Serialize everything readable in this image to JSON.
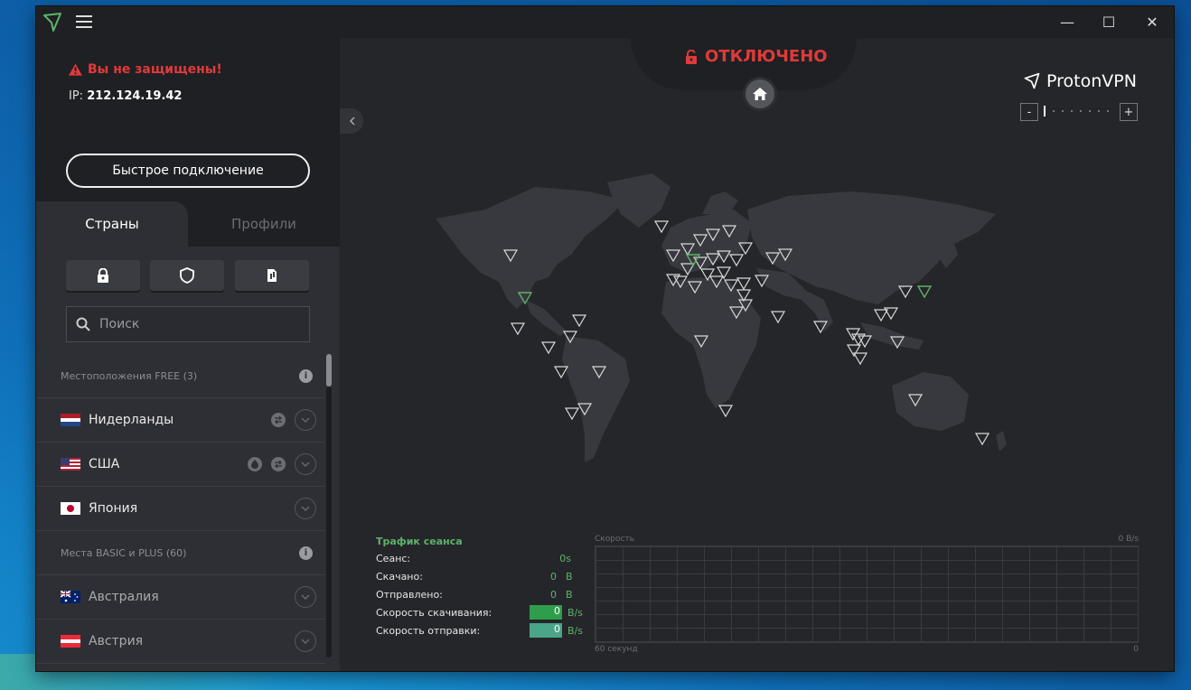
{
  "window": {
    "minimize": "—",
    "maximize": "☐",
    "close": "✕"
  },
  "sidebar": {
    "warning": "Вы не защищены!",
    "ip_label": "IP:",
    "ip_value": "212.124.19.42",
    "quick_connect": "Быстрое подключение",
    "tabs": [
      "Страны",
      "Профили"
    ],
    "search_placeholder": "Поиск",
    "sections": [
      {
        "label": "Местоположения FREE (3)",
        "info": "i"
      },
      {
        "label": "Места BASIC и PLUS (60)",
        "info": "i"
      }
    ],
    "free_countries": [
      {
        "name": "Нидерланды",
        "flag": "NL"
      },
      {
        "name": "США",
        "flag": "US"
      },
      {
        "name": "Япония",
        "flag": "JP"
      }
    ],
    "paid_countries": [
      {
        "name": "Австралия",
        "flag": "AU"
      },
      {
        "name": "Австрия",
        "flag": "AT"
      }
    ]
  },
  "main": {
    "status": "ОТКЛЮЧЕНО",
    "brand": "ProtonVPN",
    "zoom_minus": "-",
    "zoom_plus": "+",
    "zoom_level": 0
  },
  "stats": {
    "title": "Трафик сеанса",
    "rows": [
      {
        "label": "Сеанс:",
        "value": "0s",
        "unit": ""
      },
      {
        "label": "Скачано:",
        "value": "0",
        "unit": "B"
      },
      {
        "label": "Отправлено:",
        "value": "0",
        "unit": "B"
      },
      {
        "label": "Скорость скачивания:",
        "value": "0",
        "unit": "B/s"
      },
      {
        "label": "Скорость отправки:",
        "value": "0",
        "unit": "B/s"
      }
    ]
  },
  "graph": {
    "title": "Скорость",
    "top_right": "0",
    "top_right_unit": "B/s",
    "bottom_left": "60 секунд",
    "bottom_right": "0"
  },
  "colors": {
    "danger": "#e03a3a",
    "accent_green": "#5fb26a"
  }
}
